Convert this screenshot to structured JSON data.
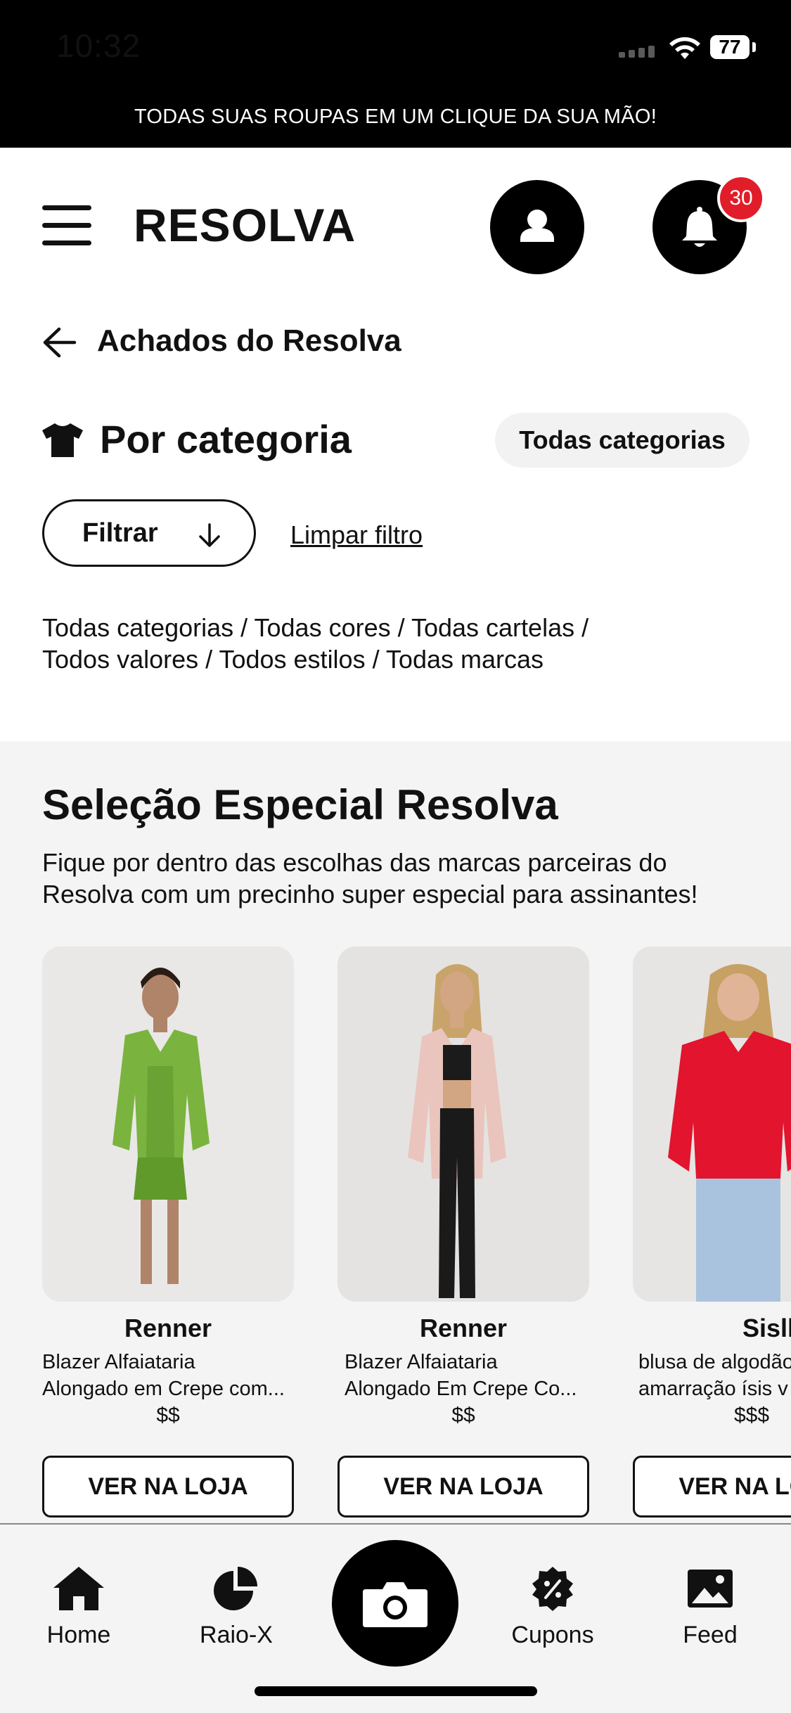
{
  "status_bar": {
    "time": "10:32",
    "battery": "77"
  },
  "banner": "TODAS SUAS ROUPAS EM UM CLIQUE DA SUA MÃO!",
  "header": {
    "brand": "RESOLVA",
    "notification_count": "30"
  },
  "page": {
    "back_title": "Achados do Resolva",
    "category_title": "Por categoria",
    "all_categories_button": "Todas categorias",
    "filter_button": "Filtrar",
    "clear_filter": "Limpar filtro",
    "filter_path_line1": "Todas categorias / Todas cores / Todas cartelas /",
    "filter_path_line2": "Todos valores / Todos estilos / Todas marcas"
  },
  "selection": {
    "title": "Seleção Especial Resolva",
    "description_line1": "Fique por dentro das escolhas das marcas parceiras do",
    "description_line2": "Resolva com um precinho super especial para assinantes!",
    "products": [
      {
        "brand": "Renner",
        "desc_line1": "Blazer Alfaiataria",
        "desc_line2": "Alongado em Crepe com...",
        "price": "$$",
        "button": "VER NA LOJA"
      },
      {
        "brand": "Renner",
        "desc_line1": "Blazer Alfaiataria",
        "desc_line2": "Alongado Em Crepe Co...",
        "price": "$$",
        "button": "VER NA LOJA"
      },
      {
        "brand": "Sislla",
        "desc_line1": "blusa de algodão",
        "desc_line2": "amarração ísis v",
        "price": "$$$",
        "button": "VER NA LOJA"
      }
    ]
  },
  "bottom_nav": {
    "items": [
      {
        "label": "Home",
        "icon": "home-icon"
      },
      {
        "label": "Raio-X",
        "icon": "pie-chart-icon"
      },
      {
        "label": "",
        "icon": "camera-icon"
      },
      {
        "label": "Cupons",
        "icon": "coupon-icon"
      },
      {
        "label": "Feed",
        "icon": "image-icon"
      }
    ]
  },
  "colors": {
    "badge": "#e11d2a",
    "section_bg": "#f4f4f4",
    "primary": "#000000"
  }
}
